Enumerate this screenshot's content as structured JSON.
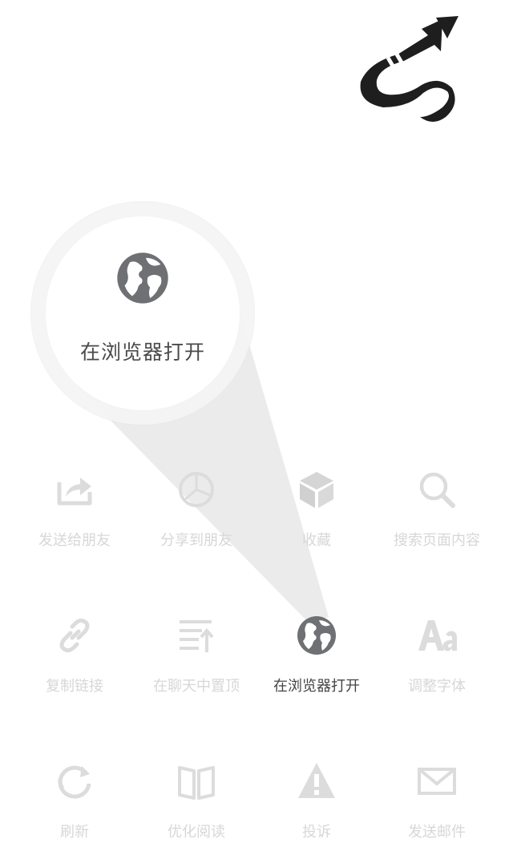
{
  "magnifier": {
    "label": "在浏览器打开",
    "icon": "globe-icon"
  },
  "menu": {
    "items": [
      {
        "label": "发送给朋友",
        "icon": "share-icon",
        "highlighted": false
      },
      {
        "label": "分享到朋友",
        "icon": "share-moments-icon",
        "highlighted": false
      },
      {
        "label": "收藏",
        "icon": "cube-icon",
        "highlighted": false
      },
      {
        "label": "搜索页面内容",
        "icon": "search-icon",
        "highlighted": false
      },
      {
        "label": "复制链接",
        "icon": "link-icon",
        "highlighted": false
      },
      {
        "label": "在聊天中置顶",
        "icon": "pin-top-icon",
        "highlighted": false
      },
      {
        "label": "在浏览器打开",
        "icon": "globe-icon",
        "highlighted": true
      },
      {
        "label": "调整字体",
        "icon": "font-icon",
        "highlighted": false
      },
      {
        "label": "刷新",
        "icon": "refresh-icon",
        "highlighted": false
      },
      {
        "label": "优化阅读",
        "icon": "book-icon",
        "highlighted": false
      },
      {
        "label": "投诉",
        "icon": "warning-icon",
        "highlighted": false
      },
      {
        "label": "发送邮件",
        "icon": "mail-icon",
        "highlighted": false
      }
    ]
  },
  "colors": {
    "highlight_icon": "#6e7073",
    "dim_icon": "#dcdcdc",
    "dim_text": "#d7d7d7",
    "active_text": "#444444",
    "beam": "#ebebeb",
    "arrow": "#1e1e1e"
  }
}
